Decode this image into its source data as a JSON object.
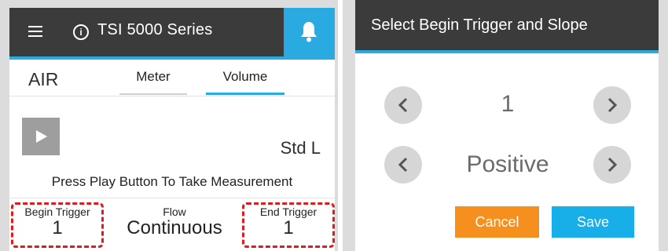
{
  "left_screen": {
    "app_bar": {
      "title": "TSI 5000 Series",
      "info_icon_glyph": "i",
      "icons": [
        "menu-icon",
        "info-icon",
        "bell-icon"
      ]
    },
    "mode_label": "AIR",
    "tabs": [
      {
        "label": "Meter",
        "active": false
      },
      {
        "label": "Volume",
        "active": true
      }
    ],
    "unit": "Std L",
    "instruction": "Press Play Button To Take Measurement",
    "begin_trigger": {
      "label": "Begin Trigger",
      "value": "1"
    },
    "flow": {
      "label": "Flow",
      "value": "Continuous"
    },
    "end_trigger": {
      "label": "End Trigger",
      "value": "1"
    }
  },
  "dialog": {
    "title": "Select Begin Trigger and Slope",
    "trigger_value": "1",
    "slope_value": "Positive",
    "cancel_label": "Cancel",
    "save_label": "Save"
  },
  "colors": {
    "app_bar": "#3b3b3b",
    "accent": "#29abe2",
    "cancel": "#f5901e",
    "save": "#18aee8",
    "highlight_outline": "#d81e1e"
  }
}
